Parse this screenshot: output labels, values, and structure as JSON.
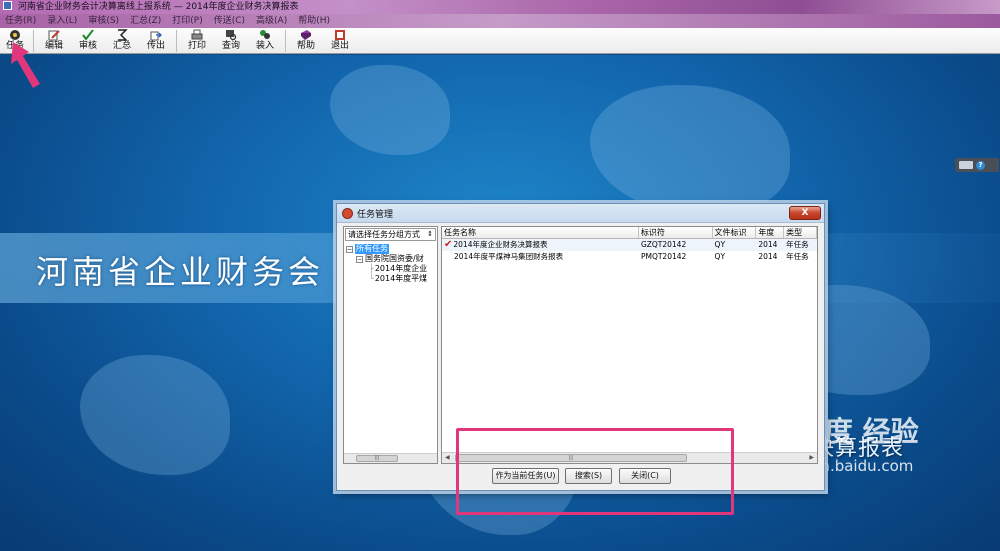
{
  "window": {
    "title": "河南省企业财务会计决算离线上报系统 — 2014年度企业财务决算报表"
  },
  "menu": [
    "任务(R)",
    "录入(L)",
    "审核(S)",
    "汇总(Z)",
    "打印(P)",
    "传送(C)",
    "高级(A)",
    "帮助(H)"
  ],
  "toolbar": {
    "task": "任务",
    "edit": "编辑",
    "audit": "审核",
    "summary": "汇总",
    "transmit": "传出",
    "print": "打印",
    "query": "查询",
    "load": "装入",
    "help": "帮助",
    "exit": "退出"
  },
  "background": {
    "main_title": "河南省企业财务会",
    "year_title": "2014年度企业财务决算报表"
  },
  "watermark": {
    "brand": "Bai度 经验",
    "url": "jingyan.baidu.com"
  },
  "dialog": {
    "title": "任务管理",
    "close_label": "X",
    "group_select": "请选择任务分组方式",
    "tree": {
      "root": "所有任务",
      "group": "国务院国资委/财",
      "items": [
        "2014年度企业",
        "2014年度平煤"
      ]
    },
    "columns": [
      "任务名称",
      "标识符",
      "文件标识",
      "年度",
      "类型"
    ],
    "rows": [
      {
        "name": "2014年度企业财务决算报表",
        "id": "GZQT20142",
        "file": "QY",
        "year": "2014",
        "type": "年任务",
        "current": true
      },
      {
        "name": "2014年度平煤神马集团财务报表",
        "id": "PMQT20142",
        "file": "QY",
        "year": "2014",
        "type": "年任务",
        "current": false
      }
    ],
    "buttons": {
      "set_current": "作为当前任务(U)",
      "search": "搜索(S)",
      "close": "关闭(C)"
    }
  },
  "colors": {
    "highlight": "#e0367b",
    "arrow": "#e0367b",
    "title_gradient_start": "#b46ab2",
    "desktop_blue": "#1266ad"
  }
}
